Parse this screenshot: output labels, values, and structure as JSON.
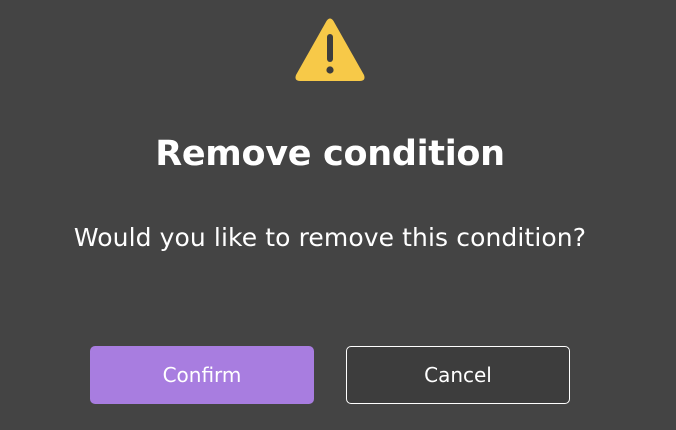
{
  "dialog": {
    "icon": "warning-icon",
    "title": "Remove condition",
    "message": "Would you like to remove this condition?",
    "confirm_label": "Confirm",
    "cancel_label": "Cancel"
  },
  "colors": {
    "background": "#444444",
    "warning": "#f7c948",
    "confirm_button": "#a87de0",
    "text": "#ffffff"
  }
}
